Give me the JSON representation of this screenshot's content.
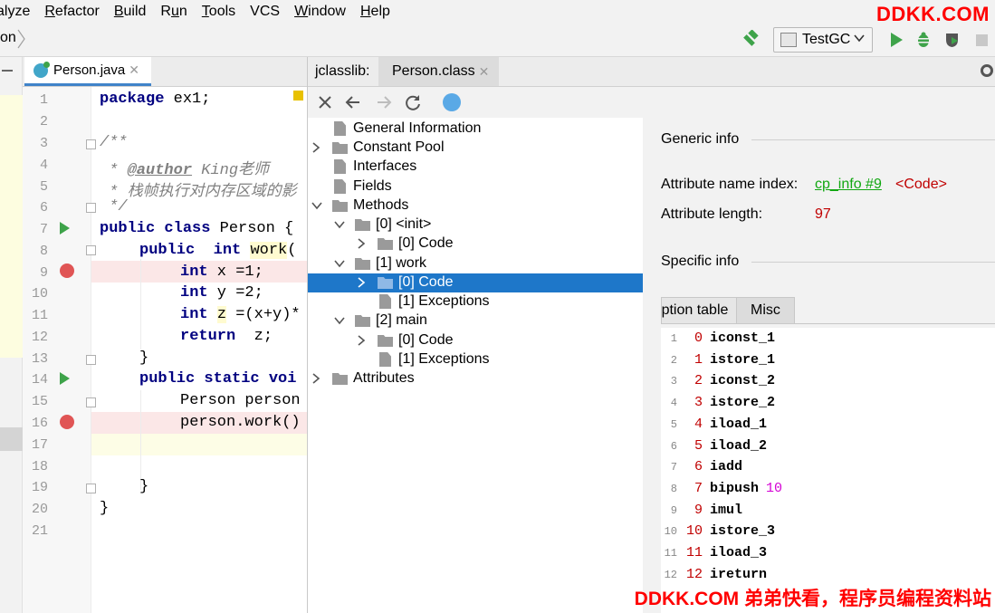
{
  "menu": {
    "items": [
      {
        "label": "alyze"
      },
      {
        "label": "Refactor"
      },
      {
        "label": "Build"
      },
      {
        "label": "Run"
      },
      {
        "label": "Tools"
      },
      {
        "label": "VCS"
      },
      {
        "label": "Window"
      },
      {
        "label": "Help"
      }
    ]
  },
  "watermark": {
    "top": "DDKK.COM",
    "bottom": "DDKK.COM 弟弟快看，程序员编程资料站",
    "color": "#ff0000"
  },
  "toolbar": {
    "breadcrumb": "on",
    "run_config": "TestGC",
    "icons": [
      "build-hammer-icon",
      "run-icon",
      "debug-icon",
      "coverage-icon",
      "stop-icon"
    ]
  },
  "editor": {
    "tab_label": "Person.java",
    "line_numbers": [
      "1",
      "2",
      "3",
      "4",
      "5",
      "6",
      "7",
      "8",
      "9",
      "10",
      "11",
      "12",
      "13",
      "14",
      "15",
      "16",
      "17",
      "18",
      "19",
      "20",
      "21"
    ],
    "lines": {
      "l1_kw": "package",
      "l1_rest": " ex1;",
      "l3": "/**",
      "l4_pre": " * ",
      "l4_tag": "@author",
      "l4_rest": " King老师",
      "l5": " * 栈帧执行对内存区域的影",
      "l6": " */",
      "l7_kw": "public class",
      "l7_rest": " Person {",
      "l8_kw1": "public",
      "l8_kw2": "int",
      "l8_name": "work",
      "l8_rest": "(",
      "l9_kw": "int",
      "l9_rest": " x =1;",
      "l10_kw": "int",
      "l10_rest": " y =2;",
      "l11_kw": "int",
      "l11_var": "z",
      "l11_rest": " =(x+y)*",
      "l12_kw": "return",
      "l12_rest": "  z;",
      "l13": "}",
      "l14_kw": "public static",
      "l14_rest": " voi",
      "l15": "Person person",
      "l16": "person.work()",
      "l19": "}",
      "l20": "}"
    }
  },
  "jclasslib": {
    "title": "jclasslib:",
    "tab_label": "Person.class",
    "toolbar_icons": [
      "close-icon",
      "back-icon",
      "forward-icon",
      "refresh-icon",
      "browser-icon"
    ],
    "tree": [
      {
        "label": "General Information"
      },
      {
        "label": "Constant Pool"
      },
      {
        "label": "Interfaces"
      },
      {
        "label": "Fields"
      },
      {
        "label": "Methods"
      },
      {
        "label": "[0] <init>"
      },
      {
        "label": "[0] Code"
      },
      {
        "label": "[1] work"
      },
      {
        "label": "[0] Code"
      },
      {
        "label": "[1] Exceptions"
      },
      {
        "label": "[2] main"
      },
      {
        "label": "[0] Code"
      },
      {
        "label": "[1] Exceptions"
      },
      {
        "label": "Attributes"
      }
    ],
    "info": {
      "generic_title": "Generic info",
      "name_index_label": "Attribute name index:",
      "name_index_link": "cp_info #9",
      "name_index_value": "<Code>",
      "length_label": "Attribute length:",
      "length_value": "97",
      "specific_title": "Specific info",
      "subtab_exception": "Exception table",
      "subtab_misc": "Misc"
    },
    "bytecode": [
      {
        "line": "1",
        "offset": "0",
        "op": "iconst_1",
        "arg": ""
      },
      {
        "line": "2",
        "offset": "1",
        "op": "istore_1",
        "arg": ""
      },
      {
        "line": "3",
        "offset": "2",
        "op": "iconst_2",
        "arg": ""
      },
      {
        "line": "4",
        "offset": "3",
        "op": "istore_2",
        "arg": ""
      },
      {
        "line": "5",
        "offset": "4",
        "op": "iload_1",
        "arg": ""
      },
      {
        "line": "6",
        "offset": "5",
        "op": "iload_2",
        "arg": ""
      },
      {
        "line": "7",
        "offset": "6",
        "op": "iadd",
        "arg": ""
      },
      {
        "line": "8",
        "offset": "7",
        "op": "bipush",
        "arg": "10"
      },
      {
        "line": "9",
        "offset": "9",
        "op": "imul",
        "arg": ""
      },
      {
        "line": "10",
        "offset": "10",
        "op": "istore_3",
        "arg": ""
      },
      {
        "line": "11",
        "offset": "11",
        "op": "iload_3",
        "arg": ""
      },
      {
        "line": "12",
        "offset": "12",
        "op": "ireturn",
        "arg": ""
      }
    ]
  }
}
